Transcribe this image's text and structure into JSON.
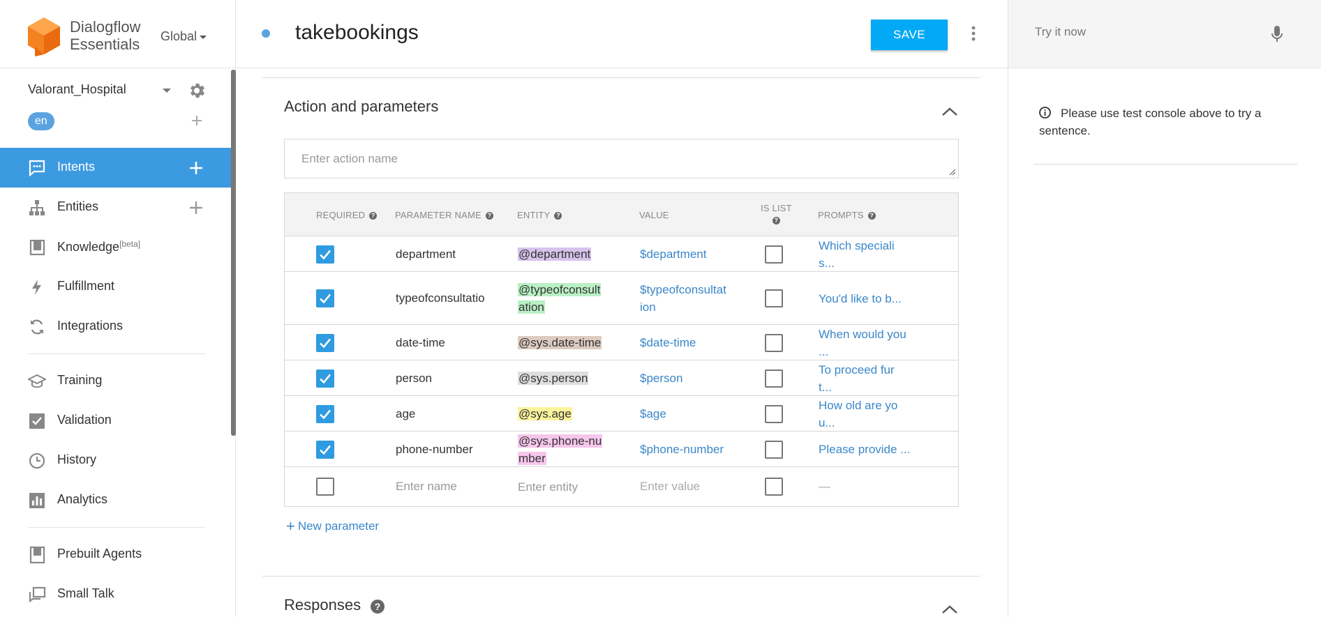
{
  "brand": {
    "line1": "Dialogflow",
    "line2": "Essentials",
    "region": "Global"
  },
  "agent": {
    "name": "Valorant_Hospital",
    "language": "en"
  },
  "nav": [
    {
      "key": "intents",
      "label": "Intents",
      "icon": "chat-bubble-icon",
      "active": true
    },
    {
      "key": "entities",
      "label": "Entities",
      "icon": "hierarchy-icon"
    },
    {
      "key": "knowledge",
      "label": "Knowledge",
      "sup": "[beta]",
      "icon": "book-icon"
    },
    {
      "key": "fulfillment",
      "label": "Fulfillment",
      "icon": "lightning-icon"
    },
    {
      "key": "integrations",
      "label": "Integrations",
      "icon": "sync-icon"
    },
    {
      "key": "training",
      "label": "Training",
      "icon": "graduation-cap-icon"
    },
    {
      "key": "validation",
      "label": "Validation",
      "icon": "checkbox-icon"
    },
    {
      "key": "history",
      "label": "History",
      "icon": "clock-icon"
    },
    {
      "key": "analytics",
      "label": "Analytics",
      "icon": "bar-chart-icon"
    },
    {
      "key": "prebuilt",
      "label": "Prebuilt Agents",
      "icon": "book-mark-icon"
    },
    {
      "key": "smalltalk",
      "label": "Small Talk",
      "icon": "chat-squares-icon"
    }
  ],
  "intent": {
    "name": "takebookings",
    "save_label": "SAVE"
  },
  "action_section": {
    "title": "Action and parameters",
    "action_placeholder": "Enter action name",
    "headers": {
      "required": "REQUIRED",
      "parameter_name": "PARAMETER NAME",
      "entity": "ENTITY",
      "value": "VALUE",
      "is_list": "IS LIST",
      "prompts": "PROMPTS"
    },
    "rows": [
      {
        "required": true,
        "name": "department",
        "entity": [
          "@department"
        ],
        "entity_color": "#d5c3ec",
        "value": [
          "$department"
        ],
        "is_list": false,
        "prompt": [
          "Which speciali",
          "s..."
        ]
      },
      {
        "required": true,
        "name": "typeofconsultatio",
        "entity": [
          "@typeofconsult",
          "ation"
        ],
        "entity_color": "#b9f0c4",
        "value": [
          "$typeofconsultat",
          "ion"
        ],
        "is_list": false,
        "prompt": [
          "You'd like to b..."
        ]
      },
      {
        "required": true,
        "name": "date-time",
        "entity": [
          "@sys.date-time"
        ],
        "entity_color": "#dccbc0",
        "value": [
          "$date-time"
        ],
        "is_list": false,
        "prompt": [
          "When would you",
          "..."
        ]
      },
      {
        "required": true,
        "name": "person",
        "entity": [
          "@sys.person"
        ],
        "entity_color": "#dedede",
        "value": [
          "$person"
        ],
        "is_list": false,
        "prompt": [
          "To proceed fur",
          "t..."
        ]
      },
      {
        "required": true,
        "name": "age",
        "entity": [
          "@sys.age"
        ],
        "entity_color": "#fbf39c",
        "value": [
          "$age"
        ],
        "is_list": false,
        "prompt": [
          "How old are yo",
          "u..."
        ]
      },
      {
        "required": true,
        "name": "phone-number",
        "entity": [
          "@sys.phone-nu",
          "mber"
        ],
        "entity_color": "#f6c6ec",
        "value": [
          "$phone-number"
        ],
        "is_list": false,
        "prompt": [
          "Please provide ..."
        ]
      }
    ],
    "empty_row": {
      "name_placeholder": "Enter name",
      "entity_placeholder": "Enter entity",
      "value_placeholder": "Enter value",
      "prompt": "—"
    },
    "new_parameter": "New parameter"
  },
  "responses_section": {
    "title": "Responses"
  },
  "test_console": {
    "placeholder": "Try it now",
    "info": "Please use test console above to try a sentence."
  },
  "colors": {
    "accent": "#03a9f4",
    "active_nav": "#3c9ae0",
    "link": "#3a87c9",
    "logo": "#f58220"
  }
}
